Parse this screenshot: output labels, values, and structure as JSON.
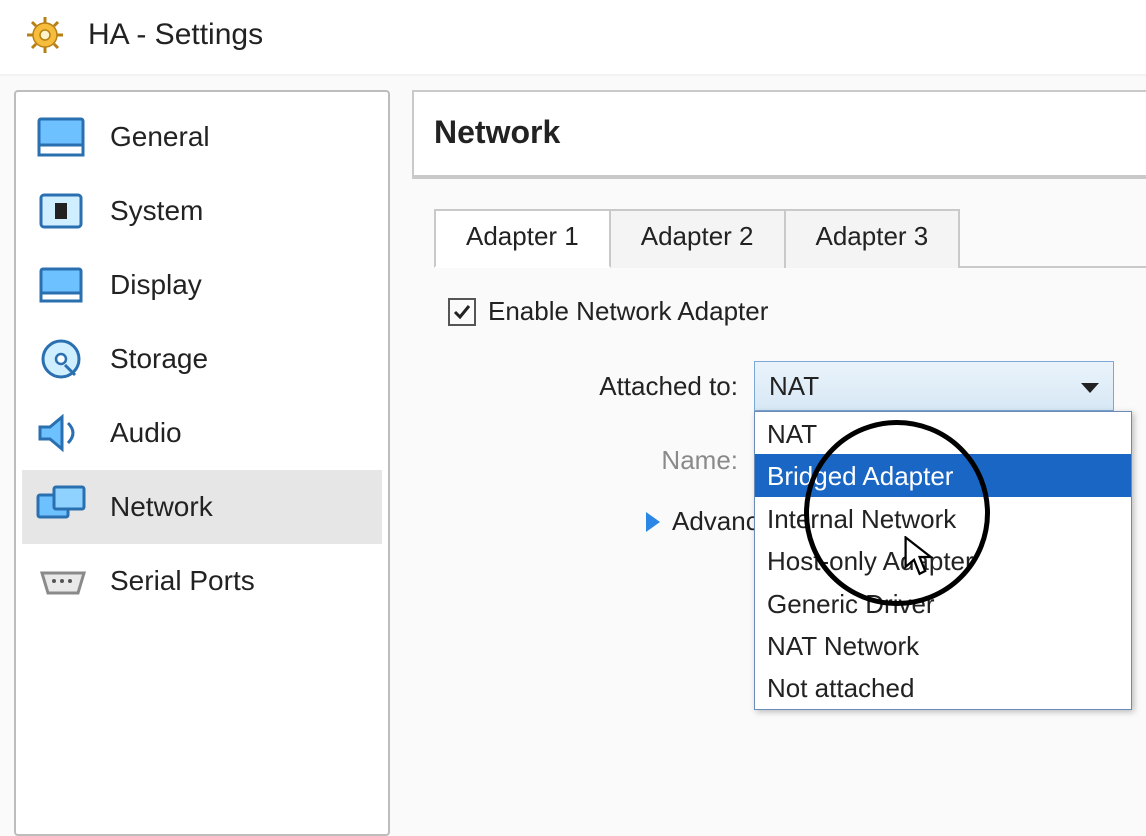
{
  "window": {
    "title": "HA - Settings"
  },
  "sidebar": {
    "items": [
      {
        "label": "General",
        "icon": "general-icon",
        "selected": false
      },
      {
        "label": "System",
        "icon": "system-icon",
        "selected": false
      },
      {
        "label": "Display",
        "icon": "display-icon",
        "selected": false
      },
      {
        "label": "Storage",
        "icon": "storage-icon",
        "selected": false
      },
      {
        "label": "Audio",
        "icon": "audio-icon",
        "selected": false
      },
      {
        "label": "Network",
        "icon": "network-icon",
        "selected": true
      },
      {
        "label": "Serial Ports",
        "icon": "serial-icon",
        "selected": false
      }
    ]
  },
  "panel": {
    "title": "Network",
    "tabs": [
      {
        "label": "Adapter 1",
        "active": true
      },
      {
        "label": "Adapter 2",
        "active": false
      },
      {
        "label": "Adapter 3",
        "active": false
      }
    ],
    "enable_checked": true,
    "enable_label": "Enable Network Adapter",
    "attached_label": "Attached to:",
    "attached_selected": "NAT",
    "attached_options": [
      {
        "label": "NAT",
        "hovered": false
      },
      {
        "label": "Bridged Adapter",
        "hovered": true
      },
      {
        "label": "Internal Network",
        "hovered": false
      },
      {
        "label": "Host-only Adapter",
        "hovered": false
      },
      {
        "label": "Generic Driver",
        "hovered": false
      },
      {
        "label": "NAT Network",
        "hovered": false
      },
      {
        "label": "Not attached",
        "hovered": false
      }
    ],
    "name_label": "Name:",
    "name_value": "",
    "advanced_label": "Advanced"
  },
  "colors": {
    "accent_blue": "#2b87e5",
    "selection_blue": "#1a66c5",
    "icon_blue_light": "#6ec1ff",
    "icon_blue_dark": "#2a6fb0"
  }
}
